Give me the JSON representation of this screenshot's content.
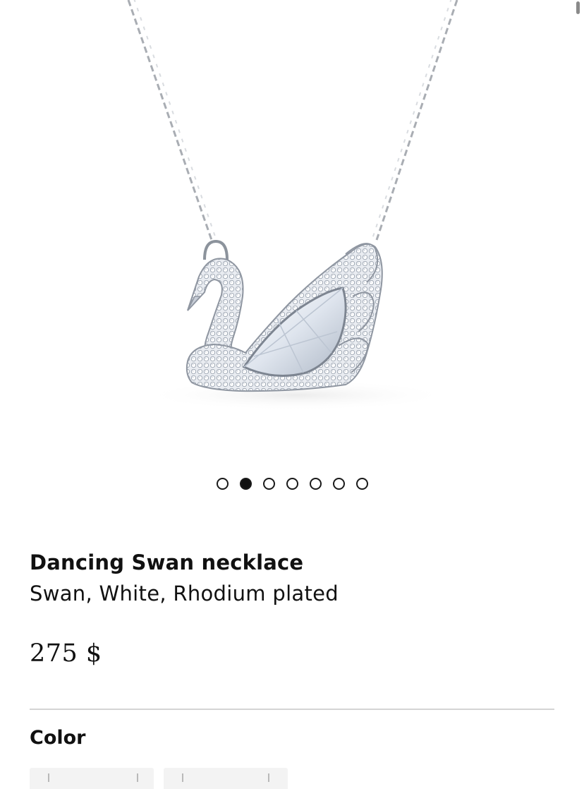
{
  "gallery": {
    "image_alt": "Dancing Swan necklace",
    "slide_count": 7,
    "active_slide_index": 1,
    "dots": [
      "slide-1",
      "slide-2",
      "slide-3",
      "slide-4",
      "slide-5",
      "slide-6",
      "slide-7"
    ]
  },
  "product": {
    "name": "Dancing Swan necklace",
    "variant": "Swan, White, Rhodium plated",
    "price": "275 $"
  },
  "color_section": {
    "label": "Color",
    "swatch_count": 2
  },
  "colors": {
    "text": "#111111",
    "divider": "#d4d4d4",
    "background": "#ffffff"
  }
}
